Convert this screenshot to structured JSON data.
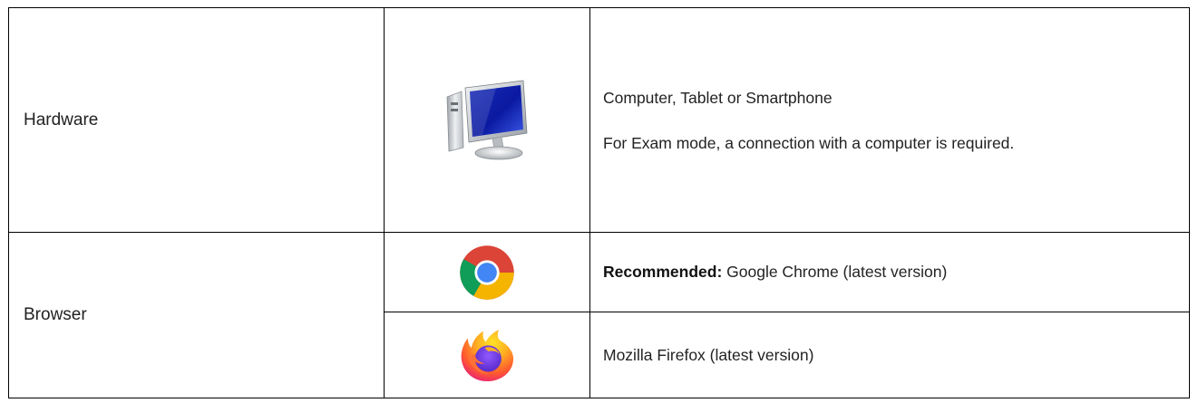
{
  "requirements": {
    "hardware": {
      "label": "Hardware",
      "icon": "desktop-computer-icon",
      "line1": "Computer, Tablet or Smartphone",
      "line2": "For Exam mode, a connection with a computer is required."
    },
    "browser": {
      "label": "Browser",
      "options": [
        {
          "icon": "chrome-icon",
          "prefix": "Recommended:",
          "text": " Google Chrome (latest version)"
        },
        {
          "icon": "firefox-icon",
          "text": "Mozilla Firefox (latest version)"
        }
      ]
    }
  },
  "colors": {
    "border": "#000000",
    "chrome_red": "#DB4437",
    "chrome_green": "#0F9D58",
    "chrome_yellow": "#F4B400",
    "chrome_blue": "#4285F4",
    "firefox_orange": "#FF7139",
    "firefox_purple": "#7542E5"
  }
}
